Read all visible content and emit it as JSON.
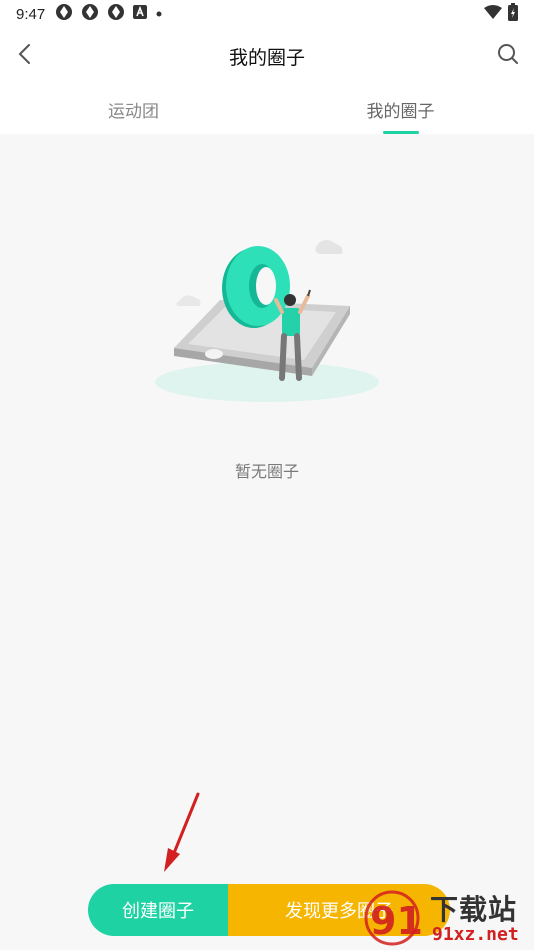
{
  "status_bar": {
    "time": "9:47",
    "left_icons": [
      "app-icon",
      "app-icon",
      "app-icon",
      "a-badge-icon",
      "dot-icon"
    ],
    "right_icons": [
      "wifi-icon",
      "battery-icon"
    ]
  },
  "header": {
    "title": "我的圈子",
    "back_icon": "chevron-left-icon",
    "search_icon": "search-icon"
  },
  "tabs": [
    {
      "label": "运动团",
      "active": false
    },
    {
      "label": "我的圈子",
      "active": true
    }
  ],
  "empty_state": {
    "message": "暂无圈子",
    "illustration": "phone-ring-person-illustration"
  },
  "bottom_actions": {
    "create_label": "创建圈子",
    "discover_label": "发现更多圈子"
  },
  "watermark": {
    "logo_text": "91",
    "title": "下载站",
    "url": "91xz.net"
  },
  "colors": {
    "accent_green": "#1ed2a4",
    "accent_orange": "#f6b500",
    "arrow_red": "#d21f1f",
    "background": "#f7f7f7"
  }
}
